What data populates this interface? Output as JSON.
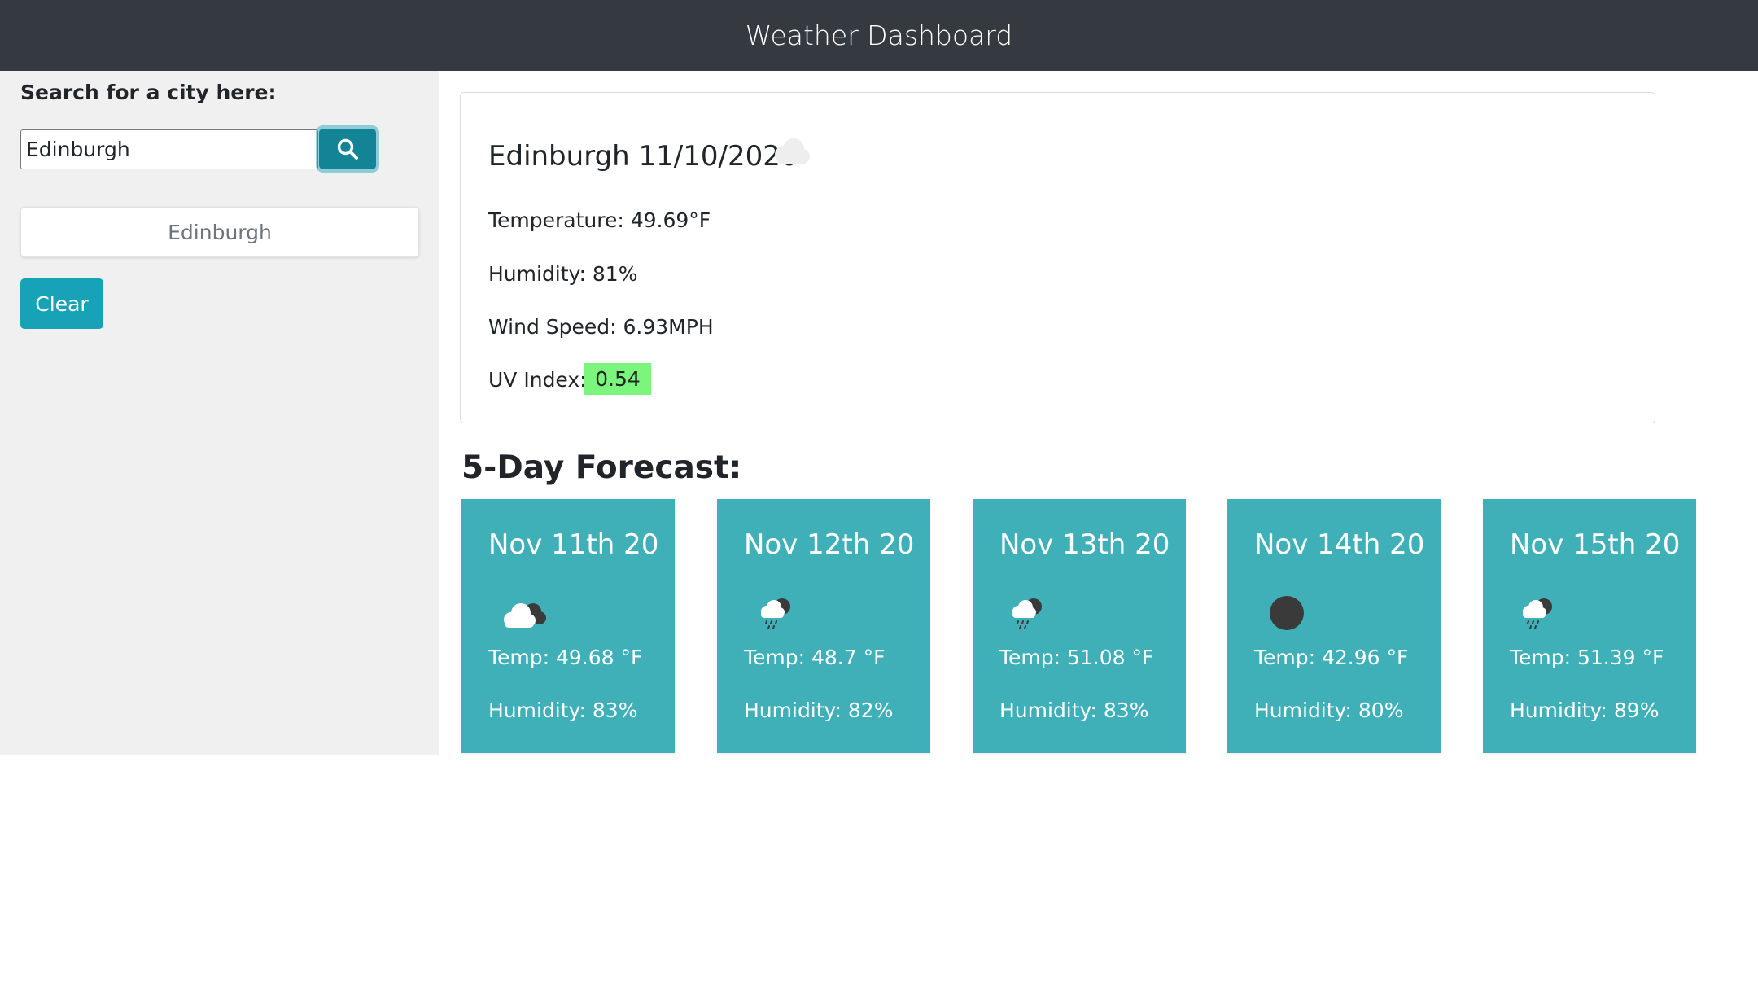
{
  "header": {
    "title": "Weather Dashboard"
  },
  "sidebar": {
    "search_label": "Search for a city here:",
    "search_value": "Edinburgh",
    "search_button_icon": "search-icon",
    "history": [
      "Edinburgh"
    ],
    "clear_label": "Clear"
  },
  "current": {
    "title": "Edinburgh 11/10/2020",
    "icon": "cloud-icon",
    "temperature": "Temperature: 49.69°F",
    "humidity": "Humidity: 81%",
    "wind": "Wind Speed: 6.93MPH",
    "uv_label": "UV Index:",
    "uv_value": "0.54",
    "uv_color": "#7cf57c"
  },
  "forecast": {
    "heading": "5-Day Forecast:",
    "card_color": "#40b0b8",
    "days": [
      {
        "date": "Nov 11th 20",
        "icon": "broken-clouds-icon",
        "temp": "Temp: 49.68 °F",
        "humidity": "Humidity: 83%"
      },
      {
        "date": "Nov 12th 20",
        "icon": "rain-icon",
        "temp": "Temp: 48.7 °F",
        "humidity": "Humidity: 82%"
      },
      {
        "date": "Nov 13th 20",
        "icon": "rain-icon",
        "temp": "Temp: 51.08 °F",
        "humidity": "Humidity: 83%"
      },
      {
        "date": "Nov 14th 20",
        "icon": "clear-night-icon",
        "temp": "Temp: 42.96 °F",
        "humidity": "Humidity: 80%"
      },
      {
        "date": "Nov 15th 20",
        "icon": "rain-icon",
        "temp": "Temp: 51.39 °F",
        "humidity": "Humidity: 89%"
      }
    ]
  }
}
